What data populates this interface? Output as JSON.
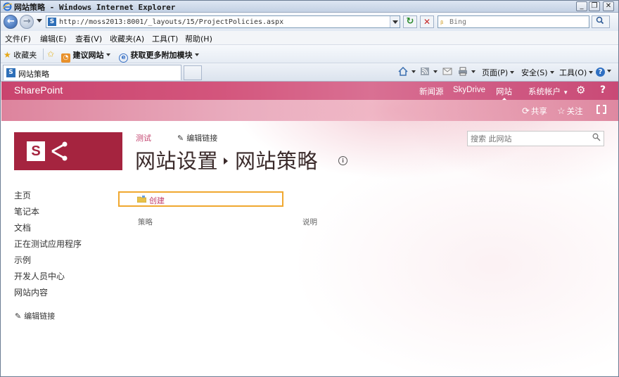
{
  "window": {
    "title": "网站策略 - Windows Internet Explorer",
    "controls": {
      "minimize": "_",
      "restore": "❐",
      "close": "✕"
    }
  },
  "address_bar": {
    "url": "http://moss2013:8001/_layouts/15/ProjectPolicies.aspx",
    "search_placeholder": "Bing",
    "refresh_glyph": "↻",
    "stop_glyph": "✕",
    "search_glyph": "🔍"
  },
  "menu": [
    "文件(F)",
    "编辑(E)",
    "查看(V)",
    "收藏夹(A)",
    "工具(T)",
    "帮助(H)"
  ],
  "favorites": {
    "label": "收藏夹",
    "items": [
      "建议网站",
      "获取更多附加模块"
    ]
  },
  "tab": {
    "label": "网站策略"
  },
  "commands": {
    "page": "页面(P)",
    "safety": "安全(S)",
    "tools": "工具(O)"
  },
  "suite_bar": {
    "brand": "SharePoint",
    "links": [
      "新闻源",
      "SkyDrive",
      "网站"
    ],
    "account": "系统帐户",
    "help": "?"
  },
  "ribbon": {
    "share": "共享",
    "follow": "关注"
  },
  "page": {
    "site_crumb": "测试",
    "edit_links": "编辑链接",
    "title_part1": "网站设置",
    "title_part2": "网站策略",
    "info": "i",
    "search_placeholder": "搜索 此网站"
  },
  "quick_launch": {
    "items": [
      "主页",
      "笔记本",
      "文档",
      "正在测试应用程序",
      "示例",
      "开发人员中心",
      "网站内容"
    ],
    "edit_links": "编辑链接"
  },
  "policies": {
    "create_label": "创建",
    "columns": [
      "策略",
      "说明"
    ]
  },
  "colors": {
    "suite_bar": "#c9446e",
    "logo_bg": "#a5243f",
    "link_accent": "#c2406c",
    "create_focus_border": "#f0a830"
  }
}
